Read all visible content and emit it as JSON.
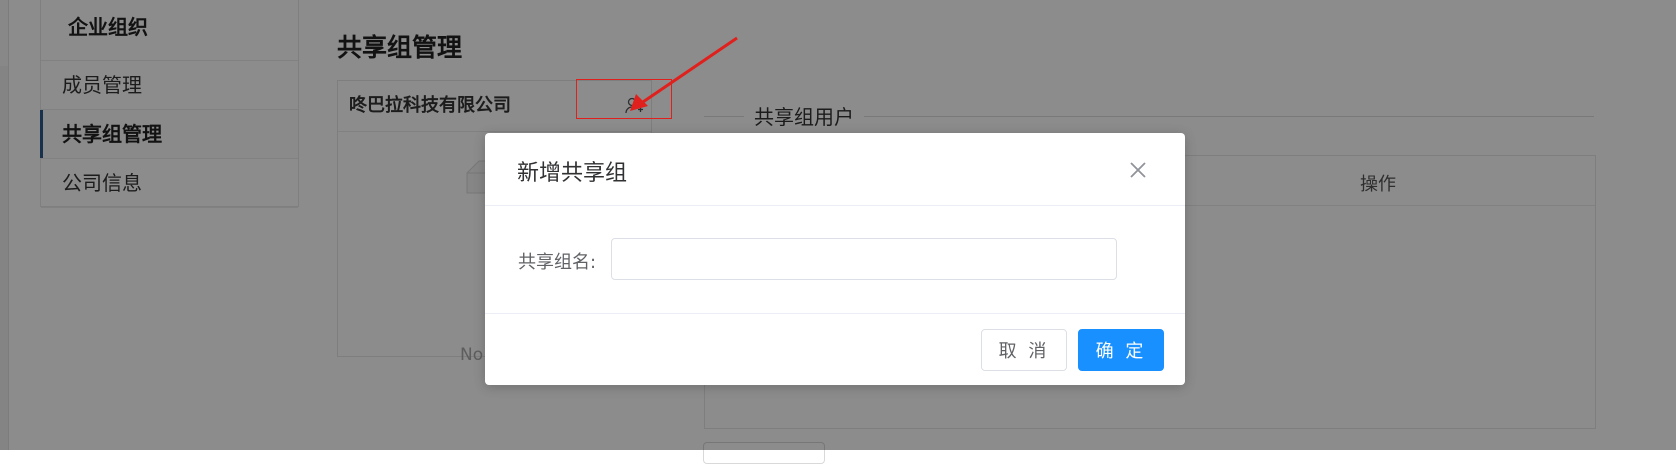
{
  "sidebar": {
    "title": "企业组织",
    "items": [
      {
        "label": "成员管理"
      },
      {
        "label": "共享组管理"
      },
      {
        "label": "公司信息"
      }
    ]
  },
  "main": {
    "page_title": "共享组管理",
    "company_name": "咚巴拉科技有限公司",
    "empty_text": "No",
    "group_users_legend": "共享组用户",
    "table_header_op": "操作"
  },
  "dialog": {
    "title": "新增共享组",
    "field_label": "共享组名:",
    "field_value": "",
    "cancel_label": "取 消",
    "confirm_label": "确 定"
  },
  "colors": {
    "primary": "#1890ff",
    "annotation": "#e0201c",
    "sidebar_active_bar": "#2c5a8c"
  }
}
